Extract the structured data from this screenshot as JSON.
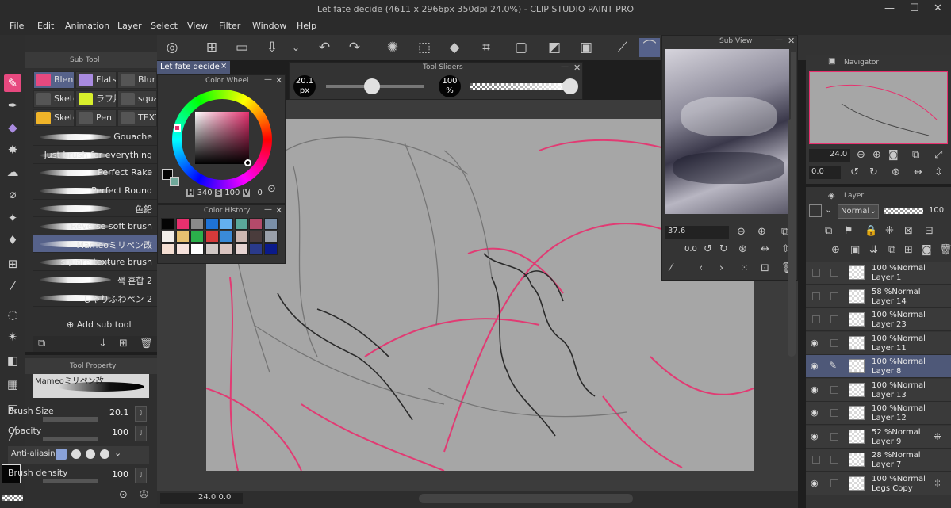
{
  "window": {
    "title": "Let fate decide (4611 x 2966px 350dpi 24.0%) - CLIP STUDIO PAINT PRO"
  },
  "menu": [
    "File",
    "Edit",
    "Animation",
    "Layer",
    "Select",
    "View",
    "Filter",
    "Window",
    "Help"
  ],
  "document_tab": {
    "label": "Let fate decide",
    "close": "×"
  },
  "sub_tool": {
    "header": "Sub Tool",
    "tabs": [
      {
        "label": "Blend",
        "icon": "blend-icon",
        "color": "#e7497f",
        "selected": true
      },
      {
        "label": "Flats",
        "icon": "flats-icon",
        "color": "#a98be0"
      },
      {
        "label": "Blur",
        "icon": "blur-icon",
        "color": "#3b3b3b"
      },
      {
        "label": "Sketc",
        "icon": "pencil-icon",
        "color": "#3b3b3b"
      },
      {
        "label": "ラフ用",
        "icon": "rough-icon",
        "color": "#d8ef2c"
      },
      {
        "label": "squa",
        "icon": "square-icon",
        "color": "#3b3b3b"
      },
      {
        "label": "Sketc",
        "icon": "pencil-icon",
        "color": "#f0b429"
      },
      {
        "label": "Pen",
        "icon": "pen-icon",
        "color": "#3b3b3b"
      },
      {
        "label": "TEXT",
        "icon": "text-icon",
        "color": "#3b3b3b"
      }
    ],
    "brushes": [
      {
        "label": "Gouache"
      },
      {
        "label": "Just brush for everything"
      },
      {
        "label": "Perfect Rake"
      },
      {
        "label": "Perfect Round"
      },
      {
        "label": "色鉛"
      },
      {
        "label": "Reverse soft brush"
      },
      {
        "label": "Mameoミリペン改",
        "selected": true
      },
      {
        "label": "square texture brush"
      },
      {
        "label": "색 혼합 2"
      },
      {
        "label": "しゃりふわペン 2"
      }
    ],
    "add_label": "Add sub tool"
  },
  "tool_property": {
    "header": "Tool Property",
    "brush_name": "Mameoミリペン改",
    "rows": [
      {
        "label": "Brush Size",
        "value": "20.1"
      },
      {
        "label": "Opacity",
        "value": "100"
      },
      {
        "label": "Anti-aliasing",
        "value": ""
      },
      {
        "label": "Brush density",
        "value": "100"
      }
    ]
  },
  "color_wheel": {
    "header": "Color Wheel",
    "h_label": "H",
    "h": "340",
    "s_label": "S",
    "s": "100",
    "v_label": "V",
    "v": "0"
  },
  "color_history": {
    "header": "Color History",
    "swatches": [
      "#050505",
      "#e8306e",
      "#8a8a8a",
      "#1f73d6",
      "#63b0f0",
      "#5aa89a",
      "#b34a6a",
      "#7a8fa8",
      "#f2eeea",
      "#e6c070",
      "#2bb04b",
      "#d63a3a",
      "#3a8ad8",
      "#cdb8b2",
      "#4a3c3c",
      "#9aa0aa",
      "#f4ded2",
      "#f6e2dc",
      "#ffffff",
      "#cfc7c4",
      "#d9c4c0",
      "#e6d4d2",
      "#2a3a8a",
      "#0a1a8a"
    ]
  },
  "tool_sliders": {
    "header": "Tool Sliders",
    "size": "20.1",
    "size_unit": "px",
    "opacity": "100",
    "opacity_unit": "%",
    "size_level": 0.47,
    "opacity_level": 1.0
  },
  "sub_view": {
    "header": "Sub View",
    "zoom": "37.6",
    "angle": "0.0"
  },
  "navigator": {
    "header": "Navigator",
    "zoom": "24.0",
    "angle": "0.0"
  },
  "layer_panel": {
    "header": "Layer",
    "blend_mode": "Normal",
    "opacity": "100",
    "layers": [
      {
        "opacity": "100 %",
        "mode": "Normal",
        "name": "Layer 1",
        "visible": false
      },
      {
        "opacity": "58 %",
        "mode": "Normal",
        "name": "Layer 14",
        "visible": false
      },
      {
        "opacity": "100 %",
        "mode": "Normal",
        "name": "Layer 23",
        "visible": false
      },
      {
        "opacity": "100 %",
        "mode": "Normal",
        "name": "Layer 11",
        "visible": true
      },
      {
        "opacity": "100 %",
        "mode": "Normal",
        "name": "Layer 8",
        "visible": true,
        "selected": true
      },
      {
        "opacity": "100 %",
        "mode": "Normal",
        "name": "Layer 13",
        "visible": true
      },
      {
        "opacity": "100 %",
        "mode": "Normal",
        "name": "Layer 12",
        "visible": true
      },
      {
        "opacity": "52 %",
        "mode": "Normal",
        "name": "Layer 9",
        "visible": true,
        "flag": true
      },
      {
        "opacity": "28 %",
        "mode": "Normal",
        "name": "Layer 7",
        "visible": false
      },
      {
        "opacity": "100 %",
        "mode": "Normal",
        "name": "Legs Copy",
        "visible": true,
        "flag": true
      }
    ]
  },
  "status_bar": {
    "zoom": "24.0",
    "angle": "0.0"
  },
  "colors": {
    "accent": "#e7497f",
    "selection": "#56628a",
    "sketch_red": "#e8306e"
  }
}
